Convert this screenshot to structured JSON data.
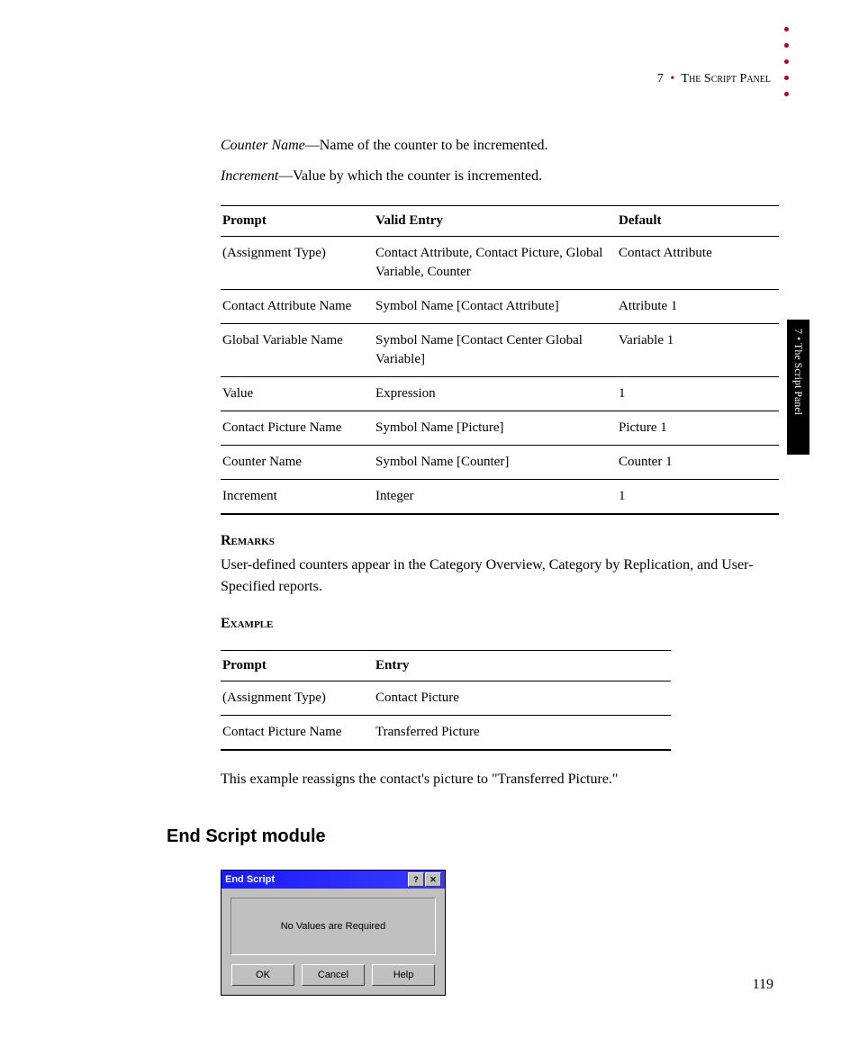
{
  "header": {
    "chapter_num": "7",
    "separator": "•",
    "chapter_title": "The Script Panel"
  },
  "side_tab": "7  •  The Script Panel",
  "definitions": [
    {
      "term": "Counter Name",
      "desc": "—Name of the counter to be incremented."
    },
    {
      "term": "Increment",
      "desc": "—Value by which the counter is incremented."
    }
  ],
  "table1": {
    "headers": [
      "Prompt",
      "Valid Entry",
      "Default"
    ],
    "rows": [
      [
        "(Assignment Type)",
        "Contact Attribute, Contact Picture, Global Variable, Counter",
        "Contact Attribute"
      ],
      [
        "Contact Attribute Name",
        "Symbol Name [Contact Attribute]",
        "Attribute 1"
      ],
      [
        "Global Variable Name",
        "Symbol Name [Contact Center Global Variable]",
        "Variable 1"
      ],
      [
        "Value",
        "Expression",
        "1"
      ],
      [
        "Contact Picture Name",
        "Symbol Name [Picture]",
        "Picture 1"
      ],
      [
        "Counter Name",
        "Symbol Name [Counter]",
        "Counter 1"
      ],
      [
        "Increment",
        "Integer",
        "1"
      ]
    ]
  },
  "remarks_heading": "Remarks",
  "remarks_text": "User-defined counters appear in the Category Overview, Category by Replication, and User-Specified reports.",
  "example_heading": "Example",
  "table2": {
    "headers": [
      "Prompt",
      "Entry"
    ],
    "rows": [
      [
        "(Assignment Type)",
        "Contact Picture"
      ],
      [
        "Contact Picture Name",
        "Transferred Picture"
      ]
    ]
  },
  "example_text": "This example reassigns the contact's picture to \"Transferred Picture.\"",
  "module_heading": "End Script module",
  "dialog": {
    "title": "End Script",
    "message": "No Values are Required",
    "buttons": [
      "OK",
      "Cancel",
      "Help"
    ]
  },
  "page_number": "119"
}
